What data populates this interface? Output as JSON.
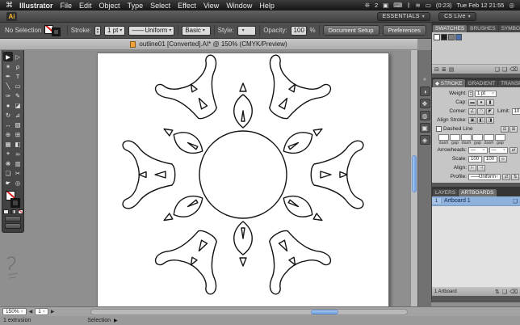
{
  "ui": {
    "caret": "▾",
    "spin_up": "▴",
    "spin_down": "▾",
    "prev": "◀",
    "next": "▶",
    "proxy": "▶",
    "line": "——"
  },
  "menubar": {
    "apple_glyph": "⌘",
    "items": [
      "Illustrator",
      "File",
      "Edit",
      "Object",
      "Type",
      "Select",
      "Effect",
      "View",
      "Window",
      "Help"
    ],
    "status": [
      {
        "name": "fan-icon",
        "glyph": "❊"
      },
      {
        "name": "input-badge",
        "text": "2"
      },
      {
        "name": "display-icon",
        "glyph": "▣"
      },
      {
        "name": "keyboard-icon",
        "glyph": "⌨"
      },
      {
        "name": "bluetooth-icon",
        "glyph": "ᛒ"
      },
      {
        "name": "wifi-icon",
        "glyph": "≋"
      },
      {
        "name": "battery-icon",
        "glyph": "▭"
      },
      {
        "name": "battery-status",
        "text": "(0:23)"
      },
      {
        "name": "clock",
        "text": "Tue Feb 12 21:55"
      },
      {
        "name": "spotlight-icon",
        "glyph": "◎"
      }
    ]
  },
  "appbar": {
    "logo": "Ai",
    "workspace": "ESSENTIALS",
    "cs_live": "CS Live"
  },
  "controlbar": {
    "no_selection": "No Selection",
    "stroke_label": "Stroke:",
    "stroke_weight": "1 pt",
    "width_profile": "Uniform",
    "brush": "Basic",
    "style_label": "Style:",
    "opacity_label": "Opacity:",
    "opacity_value": "100",
    "opacity_unit": "%",
    "document_setup": "Document Setup",
    "preferences": "Preferences"
  },
  "document_tab": {
    "title": "outline01 [Converted].AI* @ 150% (CMYK/Preview)"
  },
  "toolbar": {
    "tools": [
      {
        "name": "selection-tool",
        "glyph": "▶"
      },
      {
        "name": "direct-selection-tool",
        "glyph": "▷"
      },
      {
        "name": "magic-wand-tool",
        "glyph": "✶"
      },
      {
        "name": "lasso-tool",
        "glyph": "ρ"
      },
      {
        "name": "pen-tool",
        "glyph": "✒"
      },
      {
        "name": "type-tool",
        "glyph": "T"
      },
      {
        "name": "line-segment-tool",
        "glyph": "╲"
      },
      {
        "name": "rectangle-tool",
        "glyph": "▭"
      },
      {
        "name": "paintbrush-tool",
        "glyph": "✑"
      },
      {
        "name": "pencil-tool",
        "glyph": "✎"
      },
      {
        "name": "blob-brush-tool",
        "glyph": "●"
      },
      {
        "name": "eraser-tool",
        "glyph": "◪"
      },
      {
        "name": "rotate-tool",
        "glyph": "↻"
      },
      {
        "name": "scale-tool",
        "glyph": "⊿"
      },
      {
        "name": "width-tool",
        "glyph": "↔"
      },
      {
        "name": "free-transform-tool",
        "glyph": "▧"
      },
      {
        "name": "shape-builder-tool",
        "glyph": "⊕"
      },
      {
        "name": "perspective-grid-tool",
        "glyph": "⊞"
      },
      {
        "name": "mesh-tool",
        "glyph": "▦"
      },
      {
        "name": "gradient-tool",
        "glyph": "◧"
      },
      {
        "name": "eyedropper-tool",
        "glyph": "⌖"
      },
      {
        "name": "blend-tool",
        "glyph": "∞"
      },
      {
        "name": "symbol-sprayer-tool",
        "glyph": "❋"
      },
      {
        "name": "column-graph-tool",
        "glyph": "▥"
      },
      {
        "name": "artboard-tool",
        "glyph": "❏"
      },
      {
        "name": "slice-tool",
        "glyph": "✂"
      },
      {
        "name": "hand-tool",
        "glyph": "☛"
      },
      {
        "name": "zoom-tool",
        "glyph": "◎"
      }
    ]
  },
  "dock": {
    "expand_glyph": "«",
    "icons": [
      {
        "name": "color-panel-icon",
        "glyph": "◑"
      },
      {
        "name": "color-guide-icon",
        "glyph": "❖"
      },
      {
        "name": "appearance-icon",
        "glyph": "◍"
      },
      {
        "name": "graphic-styles-icon",
        "glyph": "▣"
      },
      {
        "name": "navigator-icon",
        "glyph": "◈"
      }
    ]
  },
  "panels": {
    "swatches": {
      "tabs": [
        "SWATCHES",
        "BRUSHES",
        "SYMBOLS"
      ],
      "active": "SWATCHES",
      "chips": [
        {
          "name": "swatch-white",
          "color": "#ffffff"
        },
        {
          "name": "swatch-black",
          "color": "#1d1d1d"
        },
        {
          "name": "swatch-gray",
          "color": "#808080"
        },
        {
          "name": "swatch-pattern",
          "color": "#4a6da8"
        }
      ],
      "footer_icons": [
        {
          "name": "swatch-libraries-icon",
          "glyph": "⊟",
          "side": "l"
        },
        {
          "name": "swatch-kinds-icon",
          "glyph": "≣",
          "side": "l"
        },
        {
          "name": "swatch-options-icon",
          "glyph": "▤",
          "side": "l"
        },
        {
          "name": "new-swatch-group-button",
          "glyph": "❑",
          "side": "r"
        },
        {
          "name": "new-swatch-button",
          "glyph": "❏",
          "side": "r"
        },
        {
          "name": "delete-swatch-button",
          "glyph": "⌫",
          "side": "r"
        }
      ]
    },
    "stroke": {
      "panel_icon": "◆",
      "tabs": [
        "STROKE",
        "GRADIENT",
        "TRANSPARE"
      ],
      "active": "STROKE",
      "weight_label": "Weight:",
      "weight_value": "1 pt",
      "cap_label": "Cap:",
      "cap_buttons": [
        {
          "name": "cap-butt-button",
          "glyph": "▬"
        },
        {
          "name": "cap-round-button",
          "glyph": "●"
        },
        {
          "name": "cap-projecting-button",
          "glyph": "▮"
        }
      ],
      "corner_label": "Corner:",
      "corner_buttons": [
        {
          "name": "corner-miter-button",
          "glyph": "∠"
        },
        {
          "name": "corner-round-button",
          "glyph": "◠"
        },
        {
          "name": "corner-bevel-button",
          "glyph": "◤"
        }
      ],
      "limit_label": "Limit:",
      "limit_value": "10",
      "limit_unit": "x",
      "align_stroke_label": "Align Stroke:",
      "align_stroke_buttons": [
        {
          "name": "align-stroke-center-button",
          "glyph": "▣"
        },
        {
          "name": "align-stroke-inside-button",
          "glyph": "◧"
        },
        {
          "name": "align-stroke-outside-button",
          "glyph": "◨"
        }
      ],
      "dashed_line_label": "Dashed Line",
      "dashed_buttons": [
        {
          "name": "preserve-dashes-button",
          "glyph": "⊟"
        },
        {
          "name": "align-dashes-button",
          "glyph": "⊞"
        }
      ],
      "dash_gap_labels": [
        "dash",
        "gap",
        "dash",
        "gap",
        "dash",
        "gap"
      ],
      "arrowheads_label": "Arrowheads:",
      "arrow_start_value": "—",
      "arrow_end_value": "—",
      "swap_icon": "⇄",
      "scale_label": "Scale:",
      "scale_start": "100",
      "scale_end": "100",
      "link_icon": "∞",
      "align_label": "Align:",
      "align_buttons": [
        {
          "name": "arrow-align-start-button",
          "glyph": "⊢"
        },
        {
          "name": "arrow-align-end-button",
          "glyph": "⊣"
        }
      ],
      "profile_label": "Profile:",
      "profile_value": "Uniform",
      "profile_buttons": [
        {
          "name": "flip-across-button",
          "glyph": "⇄"
        },
        {
          "name": "flip-along-button",
          "glyph": "⇅"
        }
      ]
    },
    "layers": {
      "tabs": [
        "LAYERS",
        "ARTBOARDS"
      ],
      "active": "ARTBOARDS",
      "artboard_number": "1",
      "artboard_name": "Artboard 1",
      "artboard_icon": "❏",
      "footer_text": "1 Artboard",
      "footer_icons": [
        {
          "name": "reorder-artboard-icon",
          "glyph": "⇅"
        },
        {
          "name": "new-artboard-button",
          "glyph": "❏"
        },
        {
          "name": "delete-artboard-button",
          "glyph": "⌫"
        }
      ]
    }
  },
  "statusbar": {
    "note": "1 extrusion",
    "zoom": "150%",
    "artboard_nav": "1",
    "status": "Selection"
  }
}
